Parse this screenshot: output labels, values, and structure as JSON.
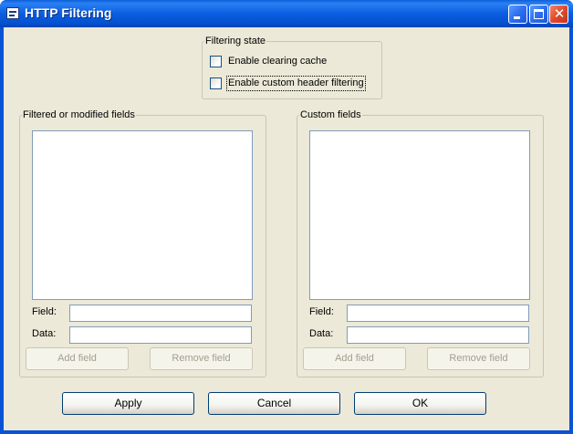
{
  "window": {
    "title": "HTTP Filtering",
    "colors": {
      "titlebar": "#0a5ee0",
      "client": "#ece9d8",
      "close_button": "#e04a2a"
    }
  },
  "filtering_state": {
    "label": "Filtering state",
    "enable_clearing_cache": {
      "label": "Enable clearing cache",
      "checked": false
    },
    "enable_custom_header_filtering": {
      "label": "Enable custom header  filtering",
      "checked": false,
      "focused": true
    }
  },
  "filtered_group": {
    "label": "Filtered or modified fields",
    "field_label": "Field:",
    "field_value": "",
    "data_label": "Data:",
    "data_value": "",
    "add_button": "Add field",
    "remove_button": "Remove field"
  },
  "custom_group": {
    "label": "Custom fields",
    "field_label": "Field:",
    "field_value": "",
    "data_label": "Data:",
    "data_value": "",
    "add_button": "Add field",
    "remove_button": "Remove field"
  },
  "footer": {
    "apply": "Apply",
    "cancel": "Cancel",
    "ok": "OK"
  }
}
